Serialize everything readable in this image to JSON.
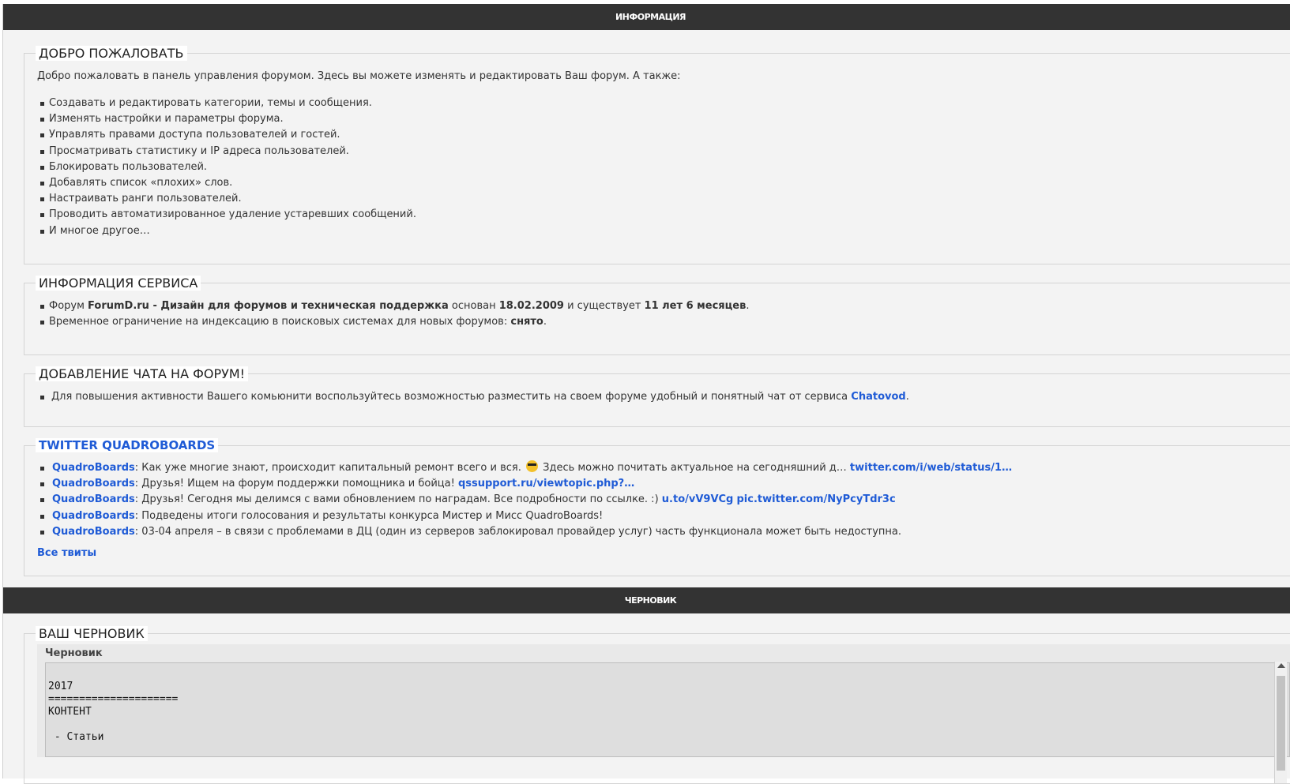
{
  "info_section": {
    "title": "Информация"
  },
  "welcome": {
    "legend": "ДОБРО ПОЖАЛОВАТЬ",
    "lead": "Добро пожаловать в панель управления форумом. Здесь вы можете изменять и редактировать Ваш форум. А также:",
    "items": [
      "Создавать и редактировать категории, темы и сообщения.",
      "Изменять настройки и параметры форума.",
      "Управлять правами доступа пользователей и гостей.",
      "Просматривать статистику и IP адреса пользователей.",
      "Блокировать пользователей.",
      "Добавлять список «плохих» слов.",
      "Настраивать ранги пользователей.",
      "Проводить автоматизированное удаление устаревших сообщений.",
      "И многое другое…"
    ]
  },
  "service": {
    "legend": "ИНФОРМАЦИЯ СЕРВИСА",
    "line1": {
      "prefix": "Форум ",
      "forum_name": "ForumD.ru - Дизайн для форумов и техническая поддержка",
      "founded_text": " основан ",
      "date": "18.02.2009",
      "exists_text": " и существует ",
      "age": "11 лет 6 месяцев",
      "suffix": "."
    },
    "line2": {
      "text": "Временное ограничение на индексацию в поисковых системах для новых форумов: ",
      "status": "снято",
      "suffix": "."
    }
  },
  "chat": {
    "legend": "ДОБАВЛЕНИЕ ЧАТА НА ФОРУМ!",
    "text": "Для повышения активности Вашего комьюнити воспользуйтесь возможностью разместить на своем форуме удобный и понятный чат от сервиса ",
    "link": "Chatovod",
    "suffix": "."
  },
  "twitter": {
    "legend": "TWITTER QUADROBOARDS",
    "tweets": [
      {
        "author": "QuadroBoards",
        "text_before": ": Как уже многие знают, происходит капитальный ремонт всего и вся. ",
        "emoji": "cool-face-emoji",
        "text_after": " Здесь можно почитать актуальное на сегодняшний д… ",
        "link1": "twitter.com/i/web/status/1…",
        "link2": ""
      },
      {
        "author": "QuadroBoards",
        "text_before": ": Друзья! Ищем на форум поддержки помощника и бойца! ",
        "link1": "qssupport.ru/viewtopic.php?…",
        "link2": ""
      },
      {
        "author": "QuadroBoards",
        "text_before": ": Друзья! Сегодня мы делимся с вами обновлением по наградам. Все подробности по ссылке. :) ",
        "link1": "u.to/vV9VCg",
        "link2": "pic.twitter.com/NyPcyTdr3c"
      },
      {
        "author": "QuadroBoards",
        "text_before": ": Подведены итоги голосования и результаты конкурса Мистер и Мисс QuadroBoards!",
        "link1": "",
        "link2": ""
      },
      {
        "author": "QuadroBoards",
        "text_before": ": 03-04 апреля – в связи с проблемами в ДЦ (один из серверов заблокировал провайдер услуг) часть функционала может быть недоступна.",
        "link1": "",
        "link2": ""
      }
    ],
    "all_link": "Все твиты"
  },
  "draft_section": {
    "title": "Черновик"
  },
  "draft": {
    "legend": "ВАШ ЧЕРНОВИК",
    "label": "Черновик",
    "content": "\n2017\n=====================\nКОНТЕНТ\n\n - Статьи"
  }
}
